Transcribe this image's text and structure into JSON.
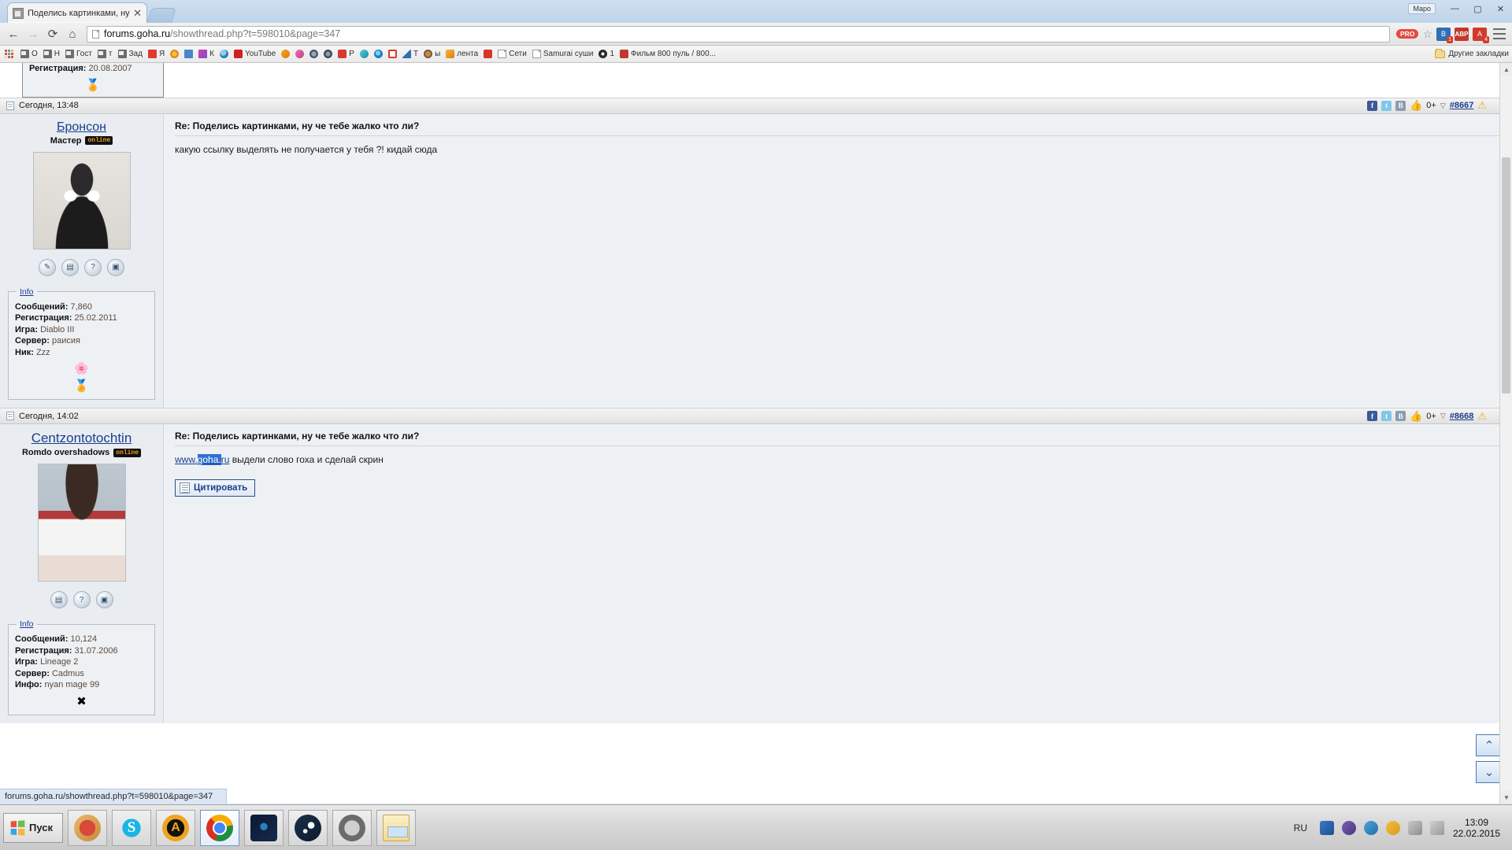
{
  "browser": {
    "tab": {
      "title": "Поделись картинками, ну ч",
      "close_label": "✕"
    },
    "mapo_label": "Мapo",
    "window_controls": {
      "minimize": "—",
      "maximize": "▢",
      "close": "✕"
    },
    "nav": {
      "back": "←",
      "forward": "→",
      "reload": "⟳",
      "home": "⌂"
    },
    "omnibox": {
      "host": "forums.goha.ru",
      "path": "/showthread.php?t=598010&page=347",
      "full": "forums.goha.ru/showthread.php?t=598010&page=347"
    },
    "extensions": [
      {
        "name": "pro-badge",
        "label": "PRO"
      },
      {
        "name": "bookmark-star",
        "label": "☆"
      },
      {
        "name": "extension-blue",
        "label": "B",
        "badge": "1"
      },
      {
        "name": "adblock",
        "label": "ABP"
      },
      {
        "name": "extension-red",
        "label": "A",
        "badge": "4"
      }
    ],
    "bookmarks": [
      {
        "label": "О",
        "icon": "gray-doc-icon"
      },
      {
        "label": "Н",
        "icon": "gray-doc-icon"
      },
      {
        "label": "Гост",
        "icon": "gray-doc-icon"
      },
      {
        "label": "т",
        "icon": "gray-doc-icon"
      },
      {
        "label": "Зад",
        "icon": "gray-doc-icon"
      },
      {
        "label": "Я",
        "icon": "yandex-icon"
      },
      {
        "label": "",
        "icon": "circle-orange-icon"
      },
      {
        "label": "",
        "icon": "blue-square-icon"
      },
      {
        "label": "К",
        "icon": "k-icon"
      },
      {
        "label": "",
        "icon": "globe-icon"
      },
      {
        "label": "YouTube",
        "icon": "youtube-icon"
      },
      {
        "label": "",
        "icon": "warn-orange-icon"
      },
      {
        "label": "",
        "icon": "pink-icon"
      },
      {
        "label": "",
        "icon": "dark-circle-icon"
      },
      {
        "label": "",
        "icon": "dark-circle-icon"
      },
      {
        "label": "Р",
        "icon": "red-square-icon"
      },
      {
        "label": "",
        "icon": "teal-icon"
      },
      {
        "label": "",
        "icon": "edge-blue-icon"
      },
      {
        "label": "",
        "icon": "red-outline-icon"
      },
      {
        "label": "Т",
        "icon": "blue-triangle-icon"
      },
      {
        "label": "ы",
        "icon": "brown-icon"
      },
      {
        "label": "лента",
        "icon": "orange-icon"
      },
      {
        "label": "",
        "icon": "red-square-icon"
      },
      {
        "label": "Сети",
        "icon": "doc-icon"
      },
      {
        "label": "Samurai суши",
        "icon": "doc-icon"
      },
      {
        "label": "1",
        "icon": "play-circle-icon"
      },
      {
        "label": "Фильм 800 пуль / 800...",
        "icon": "k-red-icon"
      }
    ],
    "bookmarks_right": {
      "label": "Другие закладки",
      "icon": "folder-icon"
    }
  },
  "page": {
    "partial_post": {
      "registration_label": "Регистрация:",
      "registration_value": "20.08.2007"
    },
    "posts": [
      {
        "timestamp": "Сегодня, 13:48",
        "post_number": "#8667",
        "like_count": "0+",
        "share_icons": [
          "f",
          "t",
          "B"
        ],
        "user": {
          "name": "Бронсон",
          "title": "Мастер",
          "online_badge": "online",
          "avatar": "bronson-portrait",
          "buttons": [
            "edit-icon",
            "quote-icon",
            "search-icon",
            "report-icon"
          ],
          "info": {
            "legend": "Info",
            "rows": [
              {
                "label": "Сообщений:",
                "value": "7,860"
              },
              {
                "label": "Регистрация:",
                "value": "25.02.2011"
              },
              {
                "label": "Игра:",
                "value": "Diablo III"
              },
              {
                "label": "Сервер:",
                "value": "раисия"
              },
              {
                "label": "Ник:",
                "value": "Zzz"
              }
            ],
            "decoration": "🌸"
          }
        },
        "title": "Re: Поделись картинками, ну че тебе жалко что ли?",
        "body_text": "какую ссылку выделять не получается у тебя ?! кидай сюда"
      },
      {
        "timestamp": "Сегодня, 14:02",
        "post_number": "#8668",
        "like_count": "0+",
        "share_icons": [
          "f",
          "t",
          "B"
        ],
        "user": {
          "name": "Centzontotochtin",
          "title": "Romdo overshadows",
          "online_badge": "online",
          "avatar": "anime-girl-portrait",
          "buttons": [
            "quote-icon",
            "search-icon",
            "report-icon"
          ],
          "info": {
            "legend": "Info",
            "rows": [
              {
                "label": "Сообщений:",
                "value": "10,124"
              },
              {
                "label": "Регистрация:",
                "value": "31.07.2006"
              },
              {
                "label": "Игра:",
                "value": "Lineage 2"
              },
              {
                "label": "Сервер:",
                "value": "Cadmus"
              },
              {
                "label": "Инфо:",
                "value": "nyan mage 99"
              }
            ],
            "decoration": "✖"
          }
        },
        "title": "Re: Поделись картинками, ну че тебе жалко что ли?",
        "link_prefix": "www.",
        "link_selected": "goha.",
        "link_suffix": "ru",
        "body_text": " выдели слово гоха и сделай скрин",
        "quote_button": "Цитировать"
      }
    ],
    "scroll_buttons": {
      "up": "⌃",
      "down": "⌄"
    },
    "status_bar": "forums.goha.ru/showthread.php?t=598010&page=347"
  },
  "taskbar": {
    "start_label": "Пуск",
    "items": [
      {
        "name": "ccleaner",
        "label": "CCleaner"
      },
      {
        "name": "skype",
        "label": "S"
      },
      {
        "name": "amd-gaming",
        "label": "A"
      },
      {
        "name": "chrome",
        "label": "Google Chrome",
        "active": true
      },
      {
        "name": "blizzard",
        "label": "Blizzard"
      },
      {
        "name": "steam",
        "label": "Steam"
      },
      {
        "name": "world-of-tanks",
        "label": "WoT"
      },
      {
        "name": "explorer",
        "label": "Explorer"
      }
    ],
    "language": "RU",
    "tray_icons": [
      "network-icon",
      "viber-icon",
      "skype-tray-icon",
      "power-icon",
      "volume-icon",
      "show-desktop-icon"
    ],
    "clock_time": "13:09",
    "clock_date": "22.02.2015"
  }
}
